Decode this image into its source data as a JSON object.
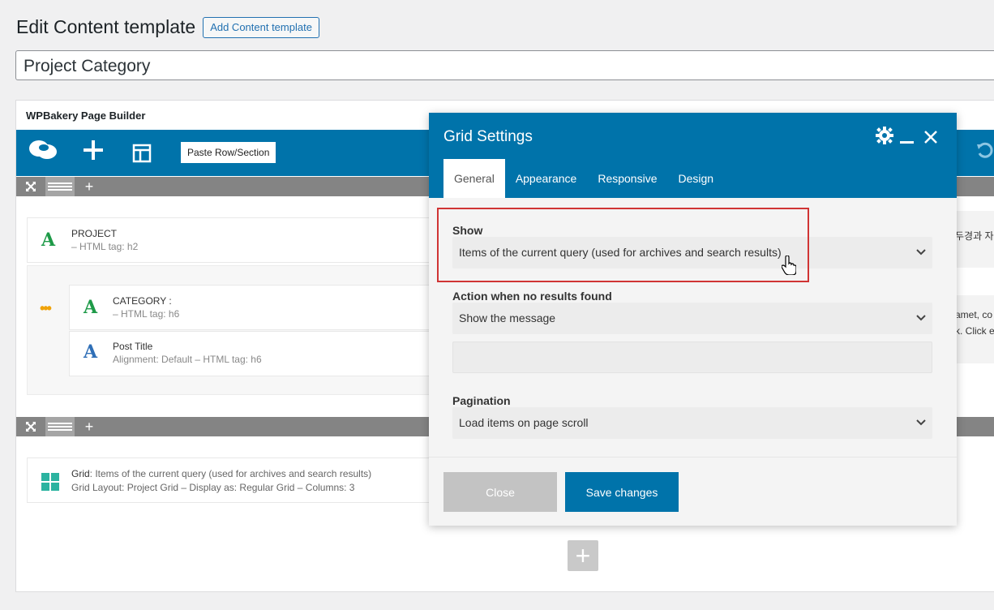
{
  "page": {
    "heading": "Edit Content template",
    "add_button": "Add Content template",
    "title_value": "Project Category"
  },
  "builder": {
    "title": "WPBakery Page Builder",
    "paste_button": "Paste Row/Section",
    "elements": {
      "project": {
        "name": "PROJECT",
        "sub": "– HTML tag: h2"
      },
      "category": {
        "name": "CATEGORY :",
        "sub": "– HTML tag: h6"
      },
      "post_title": {
        "name": "Post Title",
        "sub": "Alignment: Default  – HTML tag: h6"
      },
      "grid": {
        "name": "Grid",
        "desc": ": Items of the current query (used for archives and search results)",
        "sub": "Grid Layout: Project Grid  – Display as: Regular Grid  – Columns: 3"
      }
    },
    "bg_text": {
      "korean": "두경과 자",
      "lorem1": "amet, co",
      "lorem2": "k. Click e"
    }
  },
  "modal": {
    "title": "Grid Settings",
    "tabs": [
      "General",
      "Appearance",
      "Responsive",
      "Design"
    ],
    "active_tab": "General",
    "fields": {
      "show_label": "Show",
      "show_value": "Items of the current query (used for archives and search results)",
      "noresults_label": "Action when no results found",
      "noresults_value": "Show the message",
      "message_value": "",
      "pagination_label": "Pagination",
      "pagination_value": "Load items on page scroll"
    },
    "close_label": "Close",
    "save_label": "Save changes"
  },
  "colors": {
    "wp_blue": "#0073aa",
    "link_blue": "#2271b1",
    "icon_green": "#1e9a48",
    "icon_blue": "#2f6fb7",
    "highlight_red": "#d03434"
  },
  "icons": [
    "cloud-icon",
    "plus-icon",
    "layout-icon",
    "undo-icon",
    "fullscreen-icon",
    "drag-icon",
    "text-a-icon",
    "grid-icon",
    "gear-icon",
    "minimize-icon",
    "close-icon",
    "chevron-down-icon",
    "hand-cursor-icon"
  ]
}
